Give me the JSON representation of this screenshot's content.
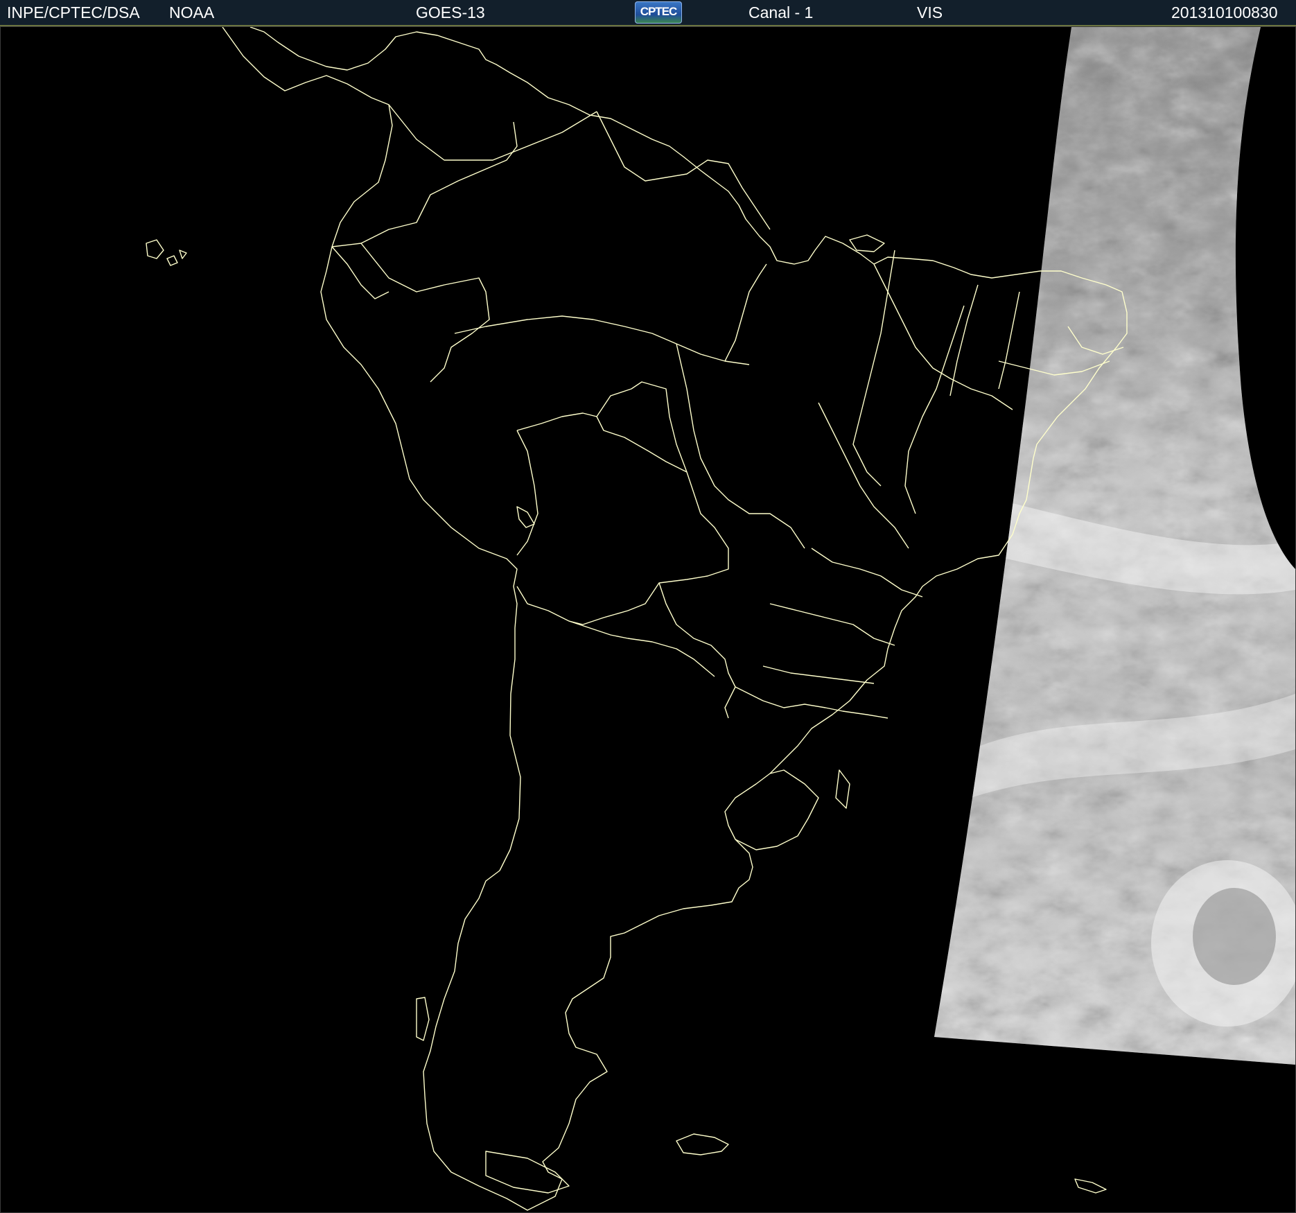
{
  "header": {
    "institution": "INPE/CPTEC/DSA",
    "agency": "NOAA",
    "satellite": "GOES-13",
    "logo_text": "CPTEC",
    "channel": "Canal - 1",
    "band": "VIS",
    "timestamp": "201310100830"
  },
  "colors": {
    "header_background": "#121f2b",
    "coastline": "#ffffcc",
    "map_background": "#000000"
  },
  "icons": {
    "logo": "cptec-logo-icon"
  }
}
